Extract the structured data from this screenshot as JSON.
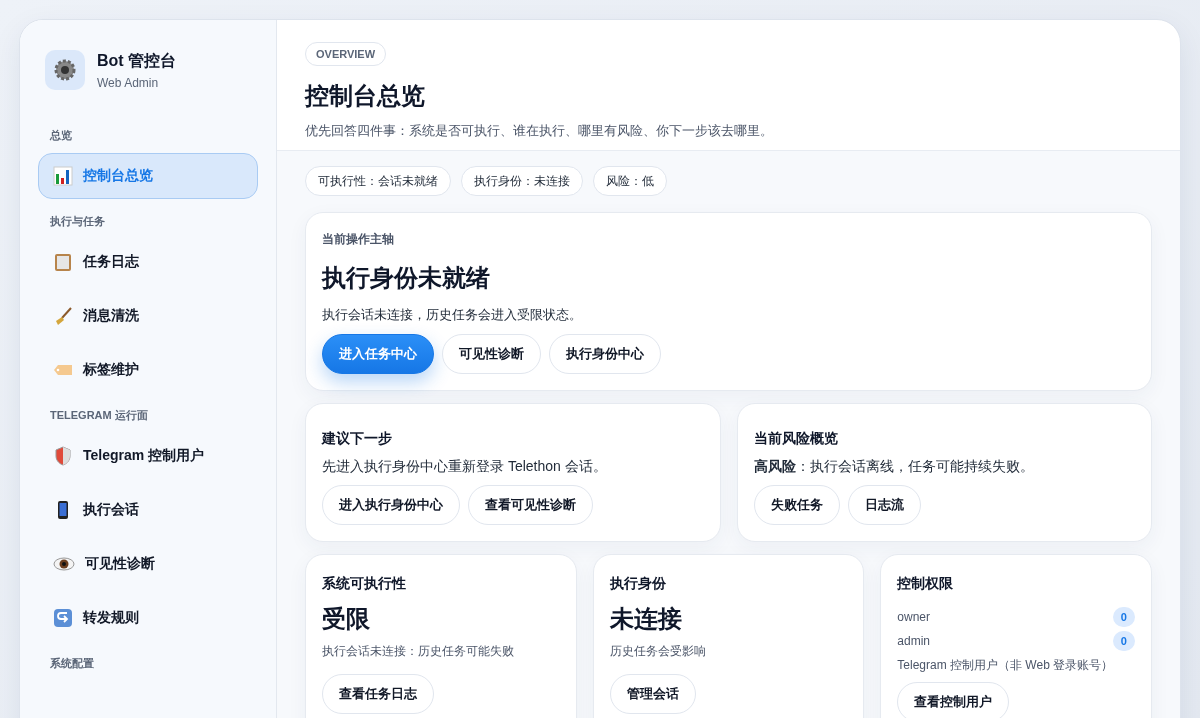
{
  "brand": {
    "title": "Bot 管控台",
    "subtitle": "Web Admin"
  },
  "nav_sections": [
    {
      "heading": "总览",
      "items": [
        {
          "label": "控制台总览",
          "selected": true
        }
      ]
    },
    {
      "heading": "执行与任务",
      "items": [
        {
          "label": "任务日志",
          "selected": false
        },
        {
          "label": "消息清洗",
          "selected": false
        },
        {
          "label": "标签维护",
          "selected": false
        }
      ]
    },
    {
      "heading": "TELEGRAM 运行面",
      "items": [
        {
          "label": "Telegram 控制用户",
          "selected": false
        },
        {
          "label": "执行会话",
          "selected": false
        },
        {
          "label": "可见性诊断",
          "selected": false
        },
        {
          "label": "转发规则",
          "selected": false
        }
      ]
    },
    {
      "heading": "系统配置"
    }
  ],
  "header": {
    "eyebrow": "OVERVIEW",
    "title": "控制台总览",
    "subtitle": "优先回答四件事：系统是否可执行、谁在执行、哪里有风险、你下一步该去哪里。"
  },
  "status_pills": [
    "可执行性：会话未就绪",
    "执行身份：未连接",
    "风险：低"
  ],
  "focus_card": {
    "label": "当前操作主轴",
    "title": "执行身份未就绪",
    "description": "执行会话未连接，历史任务会进入受限状态。",
    "buttons": [
      {
        "label": "进入任务中心",
        "kind": "primary"
      },
      {
        "label": "可见性诊断",
        "kind": "secondary"
      },
      {
        "label": "执行身份中心",
        "kind": "secondary"
      }
    ]
  },
  "info_cards": [
    {
      "title": "建议下一步",
      "description": "先进入执行身份中心重新登录 Telethon 会话。",
      "buttons": [
        "进入执行身份中心",
        "查看可见性诊断"
      ]
    },
    {
      "title": "当前风险概览",
      "description": "**高风险**：执行会话离线，任务可能持续失败。",
      "buttons": [
        "失败任务",
        "日志流"
      ]
    }
  ],
  "stat_cards": [
    {
      "title": "系统可执行性",
      "value": "受限",
      "note": "执行会话未连接：历史任务可能失败",
      "button": "查看任务日志"
    },
    {
      "title": "执行身份",
      "value": "未连接",
      "note": "历史任务会受影响",
      "button": "管理会话"
    }
  ],
  "permissions_card": {
    "title": "控制权限",
    "rows": [
      {
        "label": "owner",
        "count": "0"
      },
      {
        "label": "admin",
        "count": "0"
      }
    ],
    "note": "Telegram 控制用户（非 Web 登录账号）",
    "button": "查看控制用户"
  }
}
